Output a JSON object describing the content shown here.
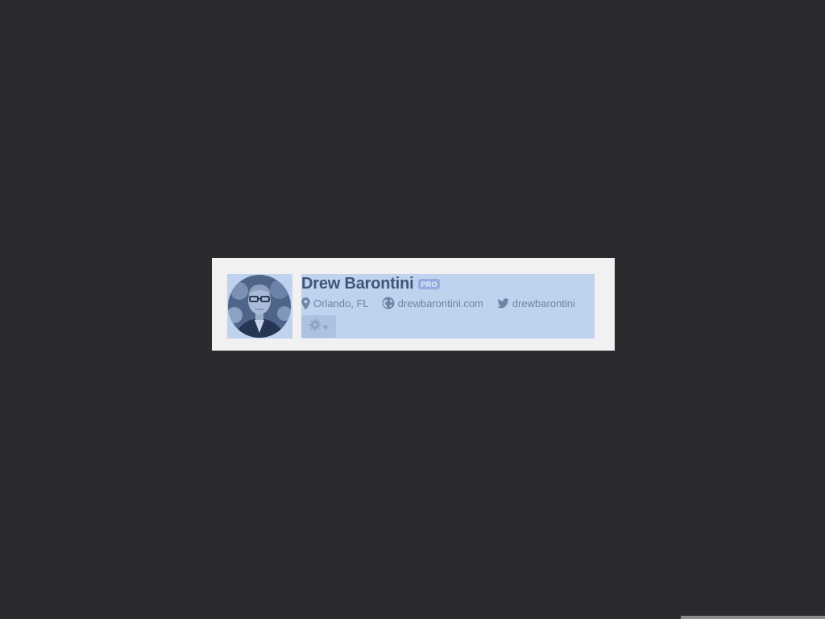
{
  "profile": {
    "name": "Drew Barontini",
    "badge": "PRO",
    "location": "Orlando, FL",
    "website": "drewbarontini.com",
    "twitter": "drewbarontini",
    "avatar_alt": "profile photo"
  },
  "icons": {
    "location": "map-pin-icon",
    "website": "globe-icon",
    "twitter": "twitter-bird-icon",
    "settings": "gear-icon",
    "dropdown": "caret-down-icon"
  },
  "colors": {
    "background": "#2a2b2f",
    "card": "#f1f1f1",
    "selection": "#bfd2ee",
    "name_text": "#3f5676",
    "meta_text": "#6f84a6",
    "badge": "#98addf"
  }
}
